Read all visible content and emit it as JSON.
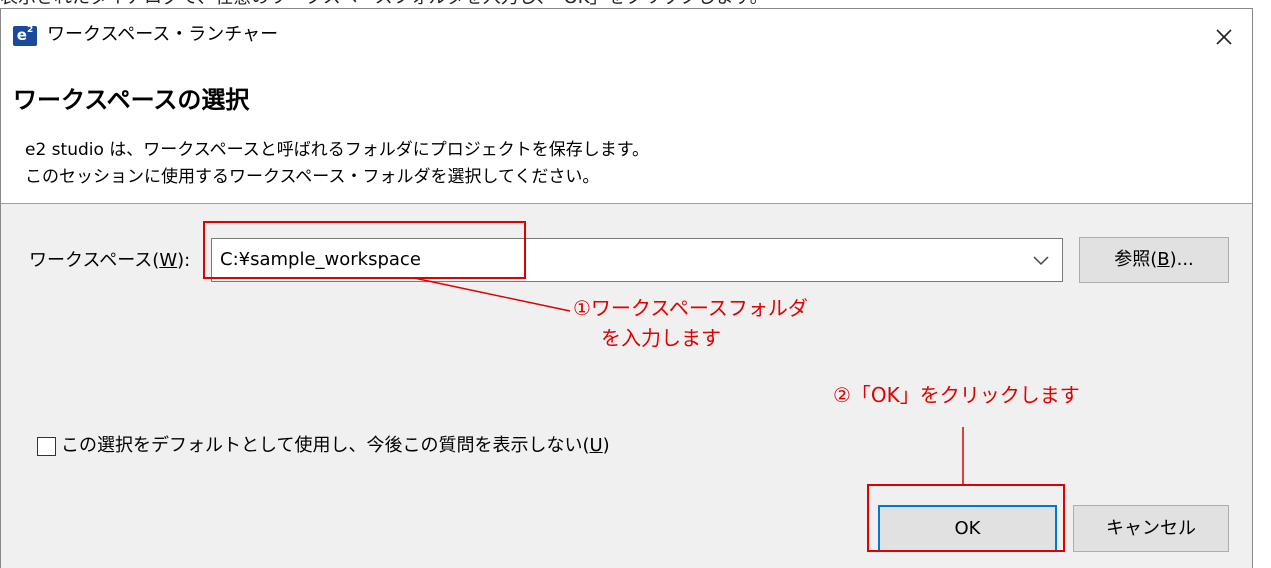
{
  "page_caption_cutoff": "表示されたダイアログで、任意のワークスペースフォルダを入力し、「OK」をクリックします。",
  "window": {
    "app_icon": "e2-icon",
    "app_icon_text": "e",
    "app_icon_sup": "2",
    "title": "ワークスペース・ランチャー",
    "close_glyph": "close-icon"
  },
  "header": {
    "heading": "ワークスペースの選択",
    "description_line1": "e2 studio は、ワークスペースと呼ばれるフォルダにプロジェクトを保存します。",
    "description_line2": "このセッションに使用するワークスペース・フォルダを選択してください。"
  },
  "workspace": {
    "label_pre": "ワークスペース(",
    "label_mnemonic": "W",
    "label_post": "):",
    "value": "C:¥sample_workspace",
    "dropdown_icon": "chevron-down-icon",
    "browse_pre": "参照(",
    "browse_mnemonic": "B",
    "browse_post": ")..."
  },
  "default_option": {
    "checked": false,
    "label_pre": "この選択をデフォルトとして使用し、今後この質問を表示しない(",
    "label_mnemonic": "U",
    "label_post": ")"
  },
  "buttons": {
    "ok": "OK",
    "cancel": "キャンセル"
  },
  "annotations": {
    "note1_line1": "①ワークスペースフォルダ",
    "note1_line2": "を入力します",
    "note2": "②「OK」をクリックします",
    "color": "#e00000"
  },
  "colors": {
    "dialog_bg": "#f0f0f0",
    "button_bg": "#e1e1e1",
    "focus_border": "#0078d7"
  }
}
